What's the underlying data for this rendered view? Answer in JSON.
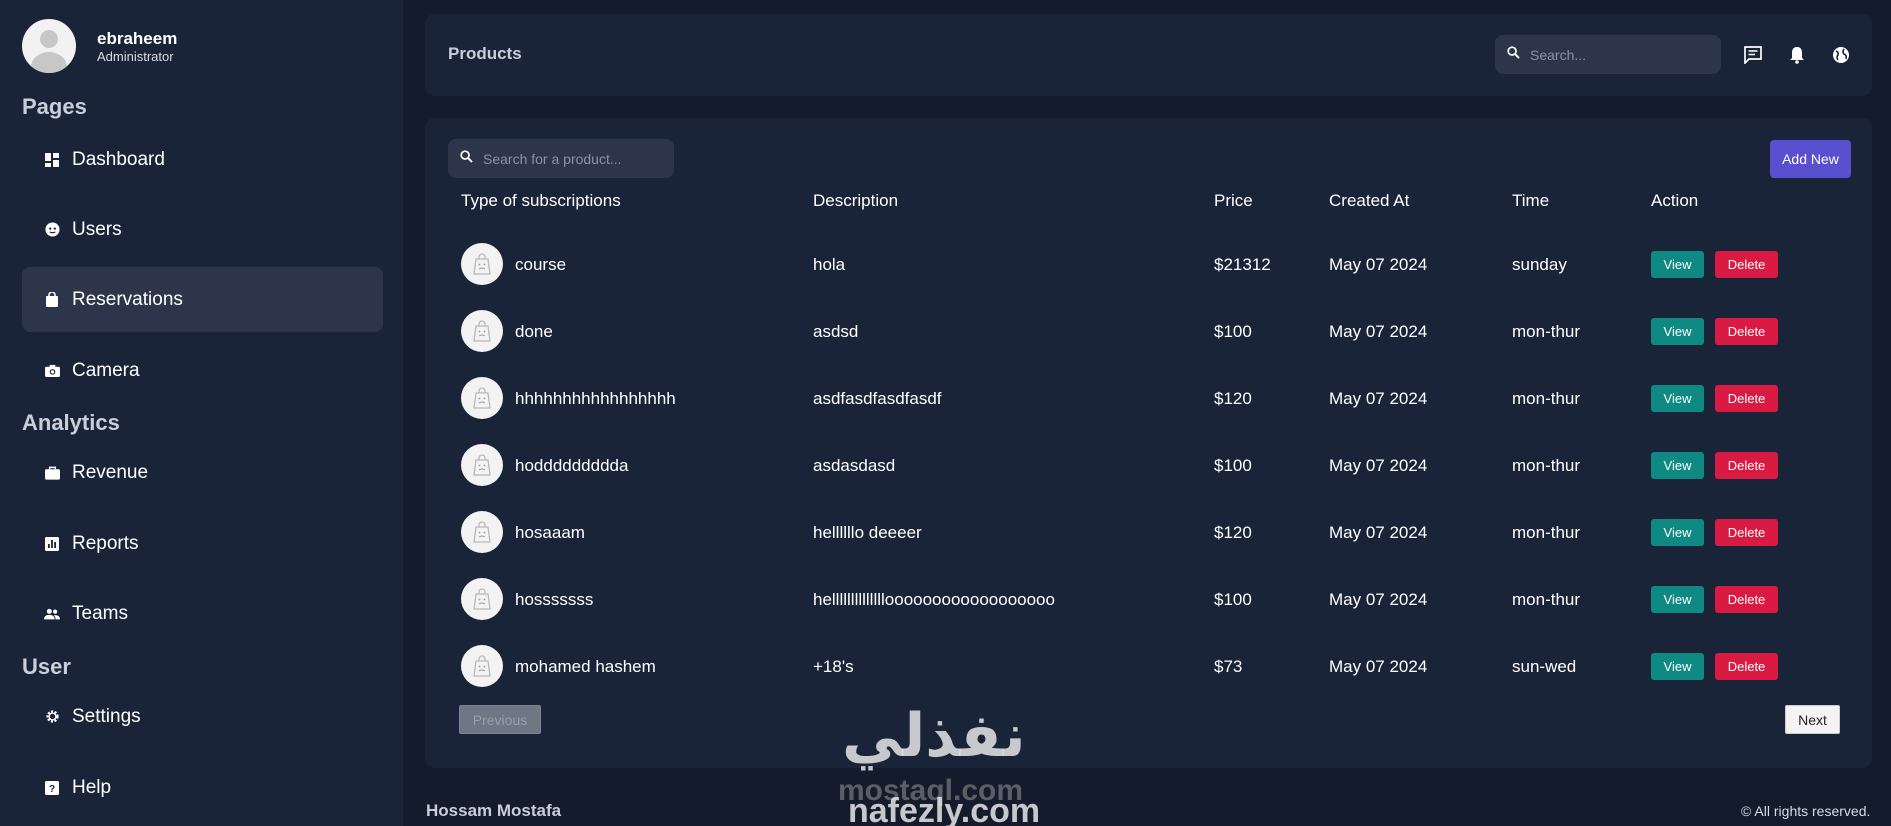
{
  "colors": {
    "bg": "#131b2c",
    "card": "#1a2439",
    "active": "#2c3549",
    "accent": "#5a4fcf",
    "view": "#0e8a83",
    "delete": "#d91a43"
  },
  "profile": {
    "name": "ebraheem",
    "role": "Administrator"
  },
  "sidebar": {
    "sections": [
      {
        "title": "Pages",
        "items": [
          {
            "label": "Dashboard",
            "icon": "dashboard-icon"
          },
          {
            "label": "Users",
            "icon": "face-icon"
          },
          {
            "label": "Reservations",
            "icon": "bag-icon",
            "active": true
          },
          {
            "label": "Camera",
            "icon": "camera-icon"
          }
        ]
      },
      {
        "title": "Analytics",
        "items": [
          {
            "label": "Revenue",
            "icon": "briefcase-icon"
          },
          {
            "label": "Reports",
            "icon": "chart-icon"
          },
          {
            "label": "Teams",
            "icon": "people-icon"
          }
        ]
      },
      {
        "title": "User",
        "items": [
          {
            "label": "Settings",
            "icon": "gear-icon"
          },
          {
            "label": "Help",
            "icon": "help-icon"
          }
        ]
      }
    ]
  },
  "header": {
    "title": "Products",
    "search_placeholder": "Search...",
    "icons": [
      "chat-icon",
      "bell-icon",
      "globe-icon"
    ]
  },
  "products": {
    "search_placeholder": "Search for a product...",
    "add_label": "Add New",
    "columns": [
      "Type of subscriptions",
      "Description",
      "Price",
      "Created At",
      "Time",
      "Action"
    ],
    "rows": [
      {
        "type": "course",
        "description": "hola",
        "price": "$21312",
        "created": "May 07 2024",
        "time": "sunday"
      },
      {
        "type": "done",
        "description": "asdsd",
        "price": "$100",
        "created": "May 07 2024",
        "time": "mon-thur"
      },
      {
        "type": "hhhhhhhhhhhhhhhhh",
        "description": "asdfasdfasdfasdf",
        "price": "$120",
        "created": "May 07 2024",
        "time": "mon-thur"
      },
      {
        "type": "hoddddddddda",
        "description": "asdasdasd",
        "price": "$100",
        "created": "May 07 2024",
        "time": "mon-thur"
      },
      {
        "type": "hosaaam",
        "description": "hellllllo deeeer",
        "price": "$120",
        "created": "May 07 2024",
        "time": "mon-thur"
      },
      {
        "type": "hosssssss",
        "description": "helllllllllllllloooooooooooooooooo",
        "price": "$100",
        "created": "May 07 2024",
        "time": "mon-thur"
      },
      {
        "type": "mohamed hashem",
        "description": "+18's",
        "price": "$73",
        "created": "May 07 2024",
        "time": "sun-wed"
      }
    ],
    "view_label": "View",
    "delete_label": "Delete",
    "prev_label": "Previous",
    "next_label": "Next"
  },
  "footer": {
    "author": "Hossam Mostafa",
    "rights": "© All rights reserved."
  },
  "watermark": {
    "arabic": "نفذلي",
    "line2": "mostaql.com",
    "line3": "nafezly.com"
  }
}
